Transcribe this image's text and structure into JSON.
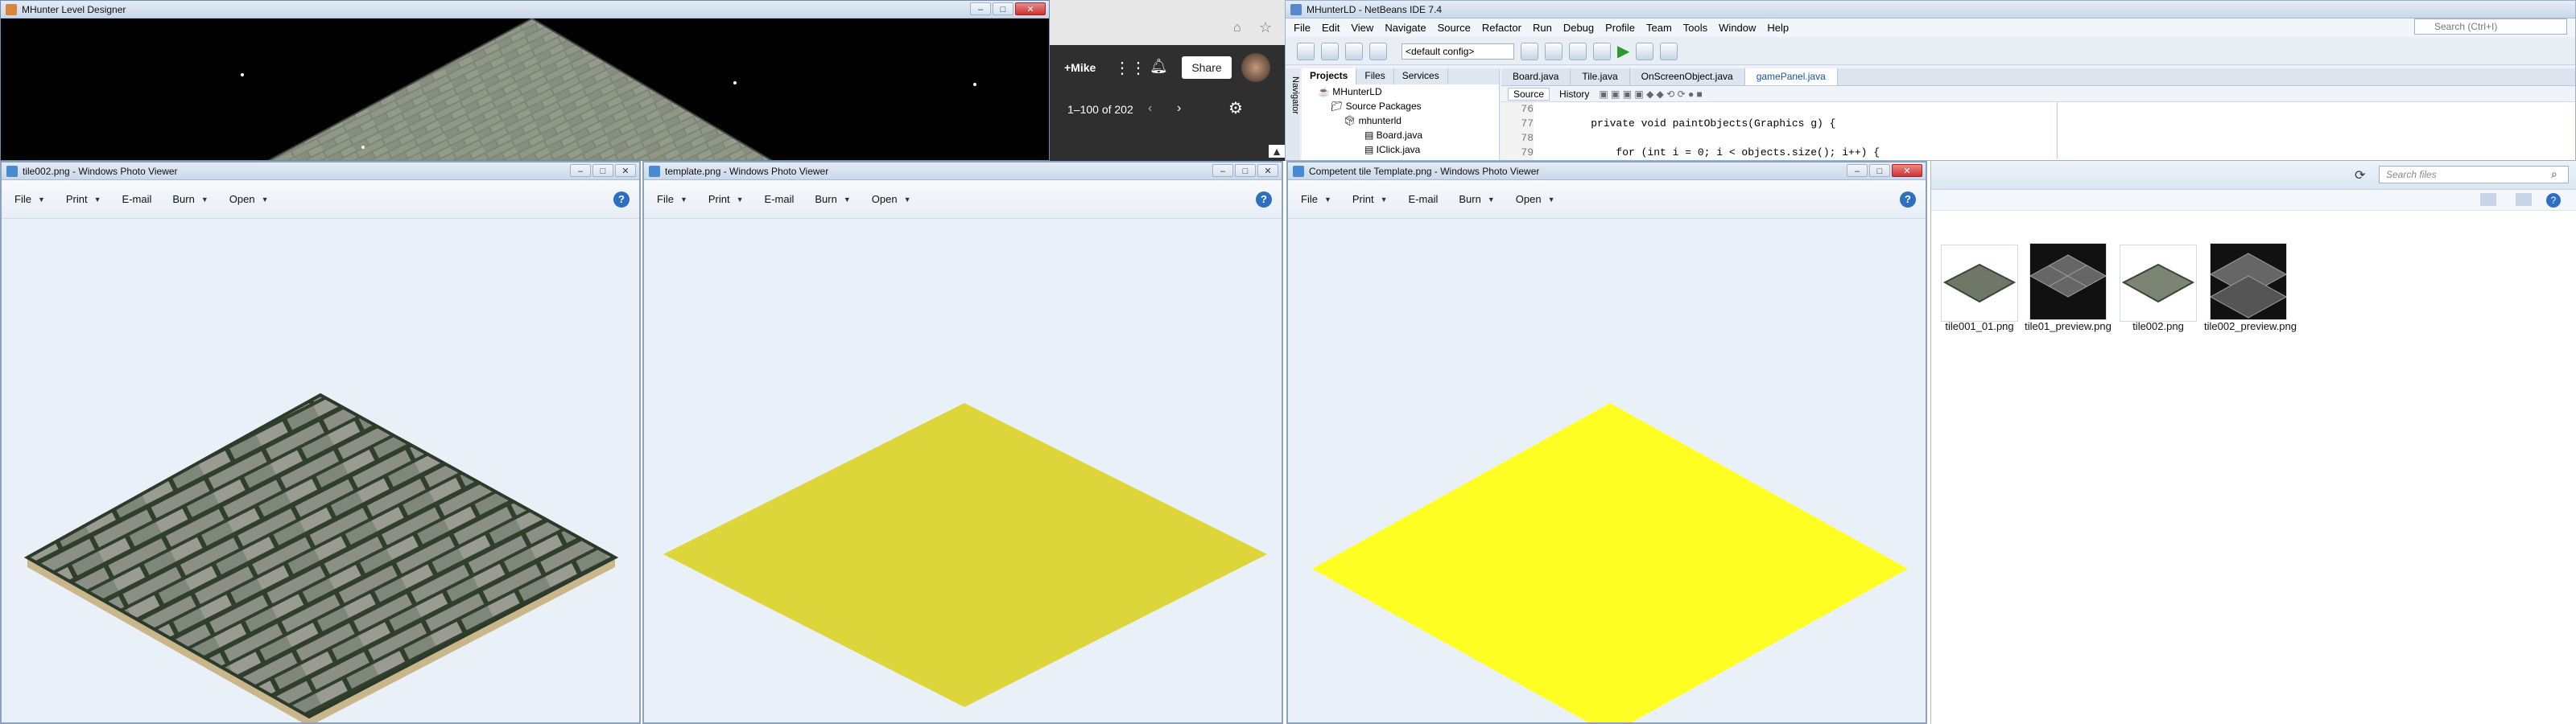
{
  "level_designer": {
    "title": "MHunter Level Designer"
  },
  "gmail": {
    "user": "+Mike",
    "share_label": "Share",
    "pagination": "1–100 of 202"
  },
  "netbeans": {
    "title": "MHunterLD - NetBeans IDE 7.4",
    "menu": [
      "File",
      "Edit",
      "View",
      "Navigate",
      "Source",
      "Refactor",
      "Run",
      "Debug",
      "Profile",
      "Team",
      "Tools",
      "Window",
      "Help"
    ],
    "search_placeholder": "Search (Ctrl+I)",
    "config": "<default config>",
    "panel_tabs": [
      "Projects",
      "Files",
      "Services"
    ],
    "navigator_label": "Navigator",
    "tree": [
      "MHunterLD",
      "Source Packages",
      "mhunterld",
      "Board.java",
      "IClick.java"
    ],
    "editor_tabs": [
      "Board.java",
      "Tile.java",
      "OnScreenObject.java",
      "gamePanel.java"
    ],
    "source_label": "Source",
    "history_label": "History",
    "lines": [
      {
        "n": "76",
        "t": ""
      },
      {
        "n": "77",
        "t": "    private void paintObjects(Graphics g) {"
      },
      {
        "n": "78",
        "t": ""
      },
      {
        "n": "79",
        "t": "        for (int i = 0; i < objects.size(); i++) {"
      }
    ]
  },
  "viewers": [
    {
      "title": "tile002.png - Windows Photo Viewer"
    },
    {
      "title": "template.png - Windows Photo Viewer"
    },
    {
      "title": "Competent tile Template.png - Windows Photo Viewer"
    }
  ],
  "viewer_menu": [
    "File",
    "Print",
    "E-mail",
    "Burn",
    "Open"
  ],
  "explorer": {
    "search_placeholder": "Search files",
    "files": [
      {
        "name": "tile001_01.png"
      },
      {
        "name": "tile01_preview.png"
      },
      {
        "name": "tile002.png"
      },
      {
        "name": "tile002_preview.png"
      }
    ]
  },
  "colors": {
    "yellow_template": "#dcd63a",
    "yellow_competent": "#ffff24",
    "stone": "#6f7868"
  }
}
